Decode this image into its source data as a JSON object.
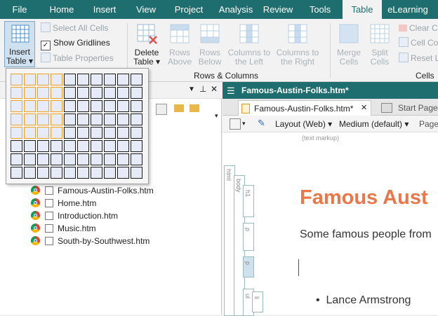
{
  "menu": {
    "tabs": [
      "File",
      "Home",
      "Insert",
      "View",
      "Project",
      "Analysis",
      "Review",
      "Tools",
      "Table",
      "eLearning"
    ],
    "active": "Table"
  },
  "ribbon": {
    "insert_table_label_1": "Insert",
    "insert_table_label_2": "Table",
    "select_all_cells": "Select All Cells",
    "show_gridlines": "Show Gridlines",
    "table_properties": "Table Properties",
    "delete_table_1": "Delete",
    "delete_table_2": "Table",
    "rows_above_1": "Rows",
    "rows_above_2": "Above",
    "rows_below_1": "Rows",
    "rows_below_2": "Below",
    "cols_left_1": "Columns to",
    "cols_left_2": "the Left",
    "cols_right_1": "Columns to",
    "cols_right_2": "the Right",
    "merge_cells_1": "Merge",
    "merge_cells_2": "Cells",
    "split_cells_1": "Split",
    "split_cells_2": "Cells",
    "clear_cell": "Clear C",
    "cell_content": "Cell Co",
    "reset_layout": "Reset L",
    "group_rows_columns": "Rows & Columns",
    "group_cells": "Cells"
  },
  "grid": {
    "rows": 8,
    "cols": 10,
    "highlight_rows": 5,
    "highlight_cols": 4
  },
  "files": [
    "Famous-Austin-Folks.htm",
    "Home.htm",
    "Introduction.htm",
    "Music.htm",
    "South-by-Southwest.htm"
  ],
  "document": {
    "title_bar": "Famous-Austin-Folks.htm*",
    "tab_active": "Famous-Austin-Folks.htm*",
    "tab_other": "Start Page",
    "layout_mode": "Layout (Web)",
    "medium": "Medium (default)",
    "page_label": "Page",
    "text_markup": "(text markup)",
    "heading": "Famous Aust",
    "paragraph": "Some famous people from",
    "bullet": "Lance Armstrong",
    "ruler_labels": [
      "html",
      "body",
      "h1",
      "p",
      "p",
      "ul",
      "li"
    ]
  },
  "colors": {
    "accent": "#1f6e6f",
    "heading": "#e9774a",
    "grid_highlight": "#f0a020"
  }
}
